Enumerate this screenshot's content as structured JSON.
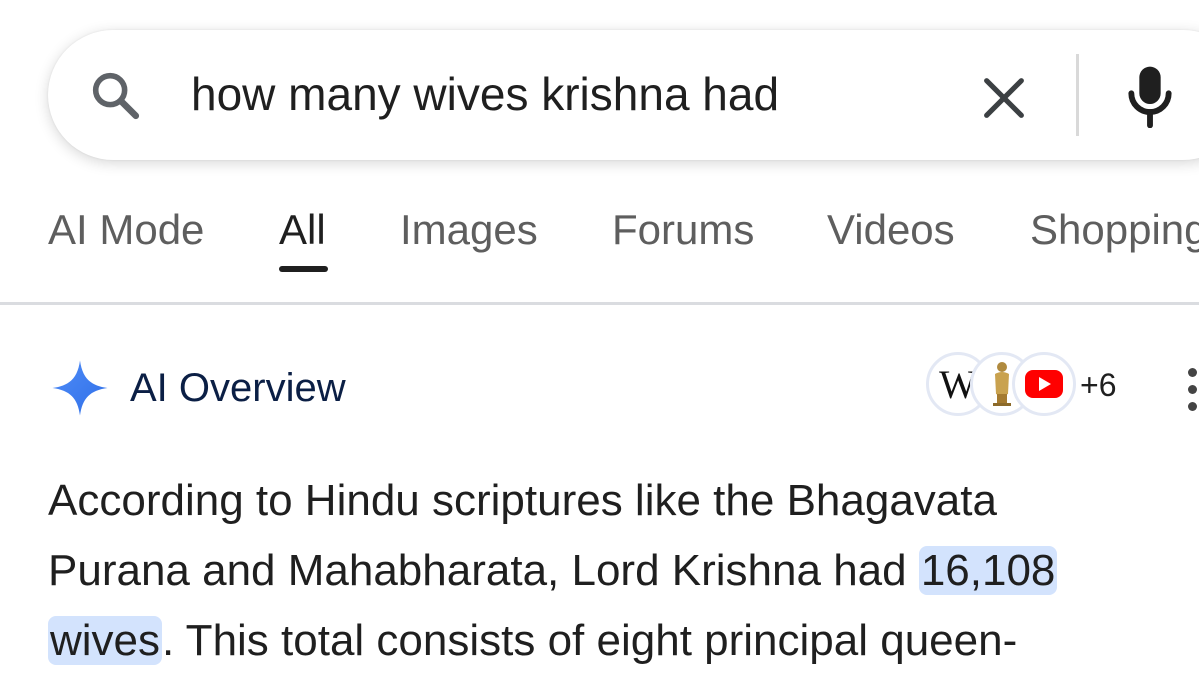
{
  "search": {
    "query": "how many wives krishna had"
  },
  "tabs": [
    {
      "label": "AI Mode",
      "active": false
    },
    {
      "label": "All",
      "active": true
    },
    {
      "label": "Images",
      "active": false
    },
    {
      "label": "Forums",
      "active": false
    },
    {
      "label": "Videos",
      "active": false
    },
    {
      "label": "Shopping",
      "active": false
    }
  ],
  "ai_overview": {
    "title": "AI Overview",
    "sources": {
      "wiki_letter": "W",
      "more_count": "+6"
    },
    "text": {
      "line1": "According to Hindu scriptures like the Bhagavata",
      "line2_pre": "Purana and Mahabharata, Lord Krishna had ",
      "highlight_a": "16,108",
      "highlight_b": "wives",
      "line3_post": ". This total consists of eight principal queen-"
    }
  },
  "colors": {
    "accent_blue": "#4285f4",
    "highlight": "#d3e3fd",
    "title_navy": "#0b1f45",
    "youtube_red": "#ff0000"
  },
  "icons": [
    "search-icon",
    "clear-icon",
    "mic-icon",
    "sparkle-icon",
    "wikipedia-icon",
    "statue-icon",
    "youtube-icon",
    "kebab-menu-icon"
  ]
}
